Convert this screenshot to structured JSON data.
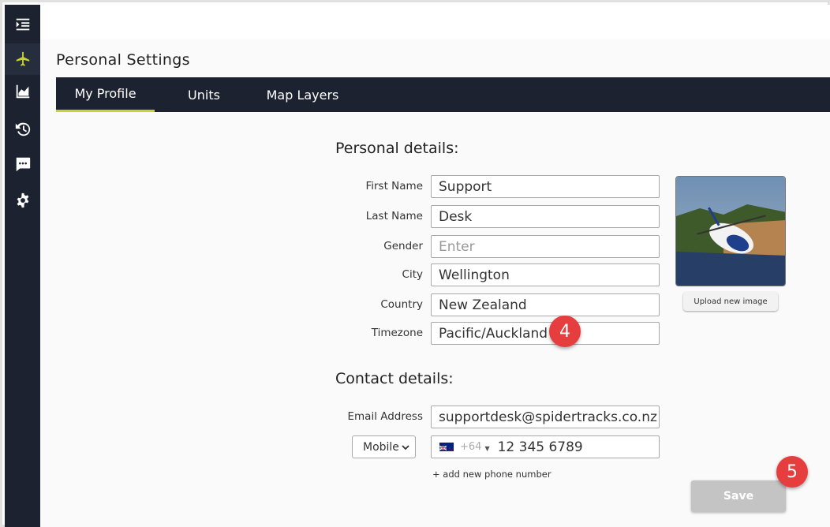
{
  "colors": {
    "sidebar": "#1c2230",
    "accent": "#c5d52b",
    "badge": "#e63e3e",
    "save_disabled": "#c4c4c4"
  },
  "sidebar": {
    "items": [
      {
        "icon": "menu-expand-icon"
      },
      {
        "icon": "airplane-icon",
        "active": true
      },
      {
        "icon": "bar-chart-icon"
      },
      {
        "icon": "history-icon"
      },
      {
        "icon": "chat-bubble-icon"
      },
      {
        "icon": "gear-icon"
      }
    ]
  },
  "page": {
    "title": "Personal Settings"
  },
  "tabs": [
    {
      "label": "My Profile",
      "active": true
    },
    {
      "label": "Units"
    },
    {
      "label": "Map Layers"
    }
  ],
  "personal": {
    "title": "Personal details:",
    "first_name": {
      "label": "First Name",
      "value": "Support"
    },
    "last_name": {
      "label": "Last Name",
      "value": "Desk"
    },
    "gender": {
      "label": "Gender",
      "value": "",
      "placeholder": "Enter"
    },
    "city": {
      "label": "City",
      "value": "Wellington"
    },
    "country": {
      "label": "Country",
      "value": "New Zealand"
    },
    "timezone": {
      "label": "Timezone",
      "value": "Pacific/Auckland"
    }
  },
  "photo": {
    "upload_label": "Upload new image"
  },
  "contact": {
    "title": "Contact details:",
    "email": {
      "label": "Email Address",
      "value": "supportdesk@spidertracks.co.nz"
    },
    "phone_type": "Mobile",
    "dial_code": "+64",
    "phone_number": "12 345 6789",
    "add_phone": "+ add new phone number"
  },
  "save_label": "Save",
  "badges": {
    "timezone": "4",
    "save": "5"
  }
}
